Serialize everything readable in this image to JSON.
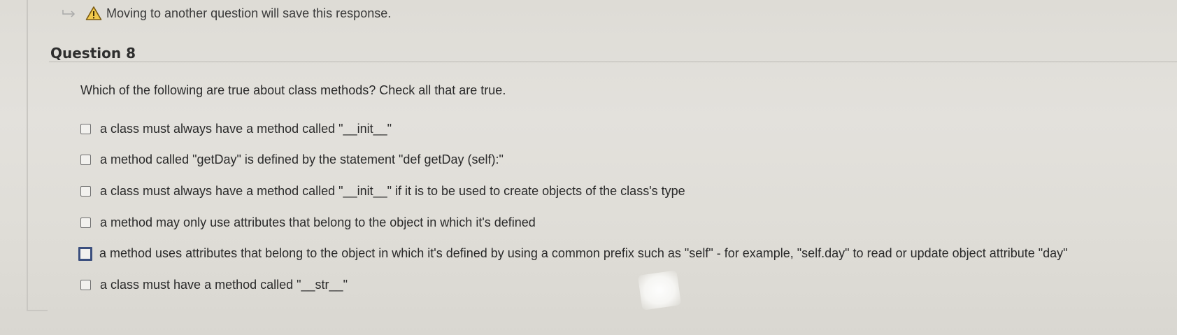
{
  "warning": {
    "arrow_icon": "arrow-right-icon",
    "icon": "warning-triangle-icon",
    "text": "Moving to another question will save this response."
  },
  "question": {
    "title": "Question 8",
    "prompt": "Which of the following are true about class methods? Check all that are true.",
    "options": [
      {
        "label": "a class must always have a method called \"__init__\"",
        "checked": false,
        "focused": false
      },
      {
        "label": "a method called \"getDay\" is defined by the statement \"def getDay (self):\"",
        "checked": false,
        "focused": false
      },
      {
        "label": "a class must always have a method called \"__init__\" if it is to be used to create objects of the class's type",
        "checked": false,
        "focused": false
      },
      {
        "label": "a method may only use attributes that belong to the object in which it's defined",
        "checked": false,
        "focused": false
      },
      {
        "label": "a method uses attributes that belong to the object in which it's defined by using a common prefix such as \"self\" - for example, \"self.day\" to read or update object attribute \"day\"",
        "checked": false,
        "focused": true
      },
      {
        "label": "a class must have a method called \"__str__\"",
        "checked": false,
        "focused": false
      }
    ]
  },
  "colors": {
    "focus_border": "#3b4f7e",
    "warning_fill": "#f2c94c",
    "warning_stroke": "#7a5a10"
  }
}
